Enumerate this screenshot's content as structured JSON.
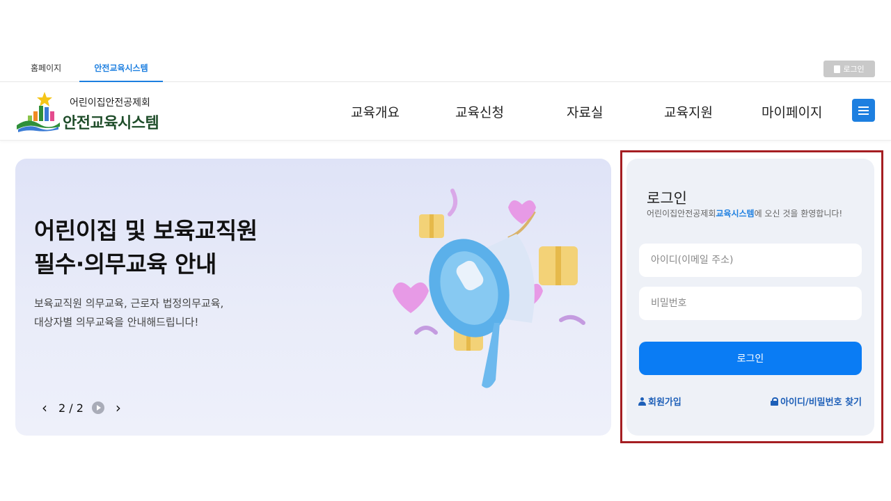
{
  "top_tabs": [
    {
      "label": "홈페이지"
    },
    {
      "label": "안전교육시스템"
    }
  ],
  "top_login_label": "로그인",
  "logo": {
    "subtitle": "어린이집안전공제회",
    "title": "안전교육시스템"
  },
  "nav": [
    "교육개요",
    "교육신청",
    "자료실",
    "교육지원",
    "마이페이지"
  ],
  "banner": {
    "title_line1": "어린이집 및 보육교직원",
    "title_line2": "필수·의무교육 안내",
    "desc_line1": "보육교직원 의무교육, 근로자 법정의무교육,",
    "desc_line2": "대상자별 의무교육을 안내해드립니다!",
    "slide_indicator": "2 / 2"
  },
  "login": {
    "title": "로그인",
    "welcome_prefix": "어린이집안전공제회",
    "welcome_highlight": "교육시스템",
    "welcome_suffix": "에 오신 것을 환영합니다!",
    "id_placeholder": "아이디(이메일 주소)",
    "pw_placeholder": "비밀번호",
    "submit_label": "로그인",
    "join_label": "회원가입",
    "find_label": "아이디/비밀번호 찾기"
  },
  "colors": {
    "accent": "#1d7fe0",
    "login_button": "#0a7cf4",
    "highlight_border": "#a51e22",
    "logo_text": "#1f4d2a"
  }
}
